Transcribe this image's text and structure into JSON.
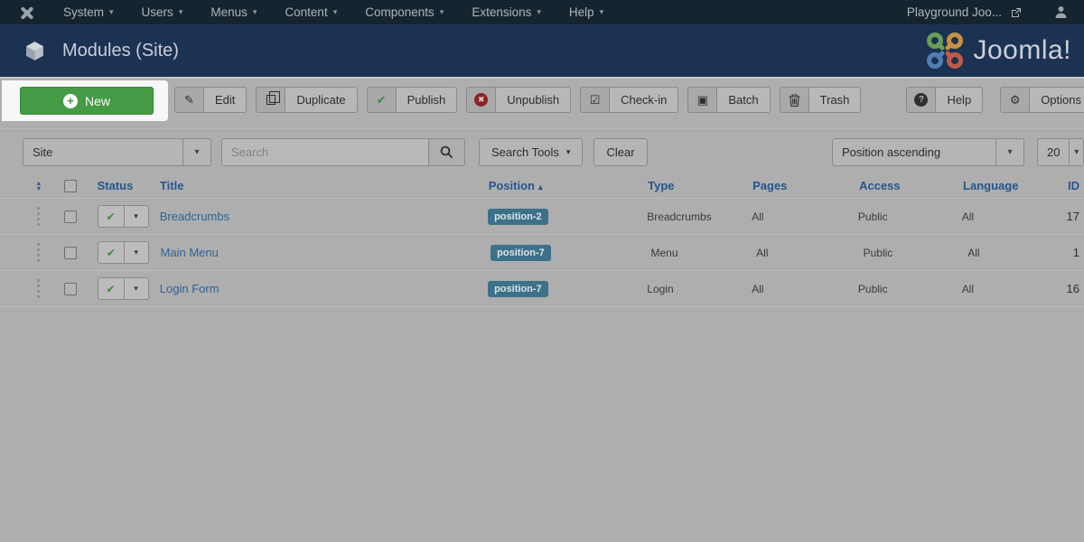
{
  "menubar": {
    "items": [
      {
        "label": "System"
      },
      {
        "label": "Users"
      },
      {
        "label": "Menus"
      },
      {
        "label": "Content"
      },
      {
        "label": "Components"
      },
      {
        "label": "Extensions"
      },
      {
        "label": "Help"
      }
    ],
    "site_name": "Playground Joo..."
  },
  "titlebar": {
    "title": "Modules (Site)",
    "logo_text": "Joomla!"
  },
  "toolbar": {
    "new_label": "New",
    "edit_label": "Edit",
    "duplicate_label": "Duplicate",
    "publish_label": "Publish",
    "unpublish_label": "Unpublish",
    "checkin_label": "Check-in",
    "batch_label": "Batch",
    "trash_label": "Trash",
    "help_label": "Help",
    "options_label": "Options"
  },
  "filters": {
    "client_selected": "Site",
    "search_placeholder": "Search",
    "search_tools_label": "Search Tools",
    "clear_label": "Clear",
    "ordering_selected": "Position ascending",
    "limit_selected": "20"
  },
  "table": {
    "headers": {
      "status": "Status",
      "title": "Title",
      "position": "Position",
      "type": "Type",
      "pages": "Pages",
      "access": "Access",
      "language": "Language",
      "id": "ID"
    },
    "rows": [
      {
        "title": "Breadcrumbs",
        "position": "position-2",
        "type": "Breadcrumbs",
        "pages": "All",
        "access": "Public",
        "language": "All",
        "id": "17"
      },
      {
        "title": "Main Menu",
        "position": "position-7",
        "type": "Menu",
        "pages": "All",
        "access": "Public",
        "language": "All",
        "id": "1"
      },
      {
        "title": "Login Form",
        "position": "position-7",
        "type": "Login",
        "pages": "All",
        "access": "Public",
        "language": "All",
        "id": "16"
      }
    ]
  },
  "icons": {
    "caret_down": "▾",
    "sort_up": "▴",
    "sort_down": "▾",
    "asc_arrow": "▴",
    "check": "✔",
    "x_mark": "✖",
    "checkin": "☑",
    "batch": "▣",
    "pencil": "✎",
    "gear": "⚙",
    "question": "?",
    "plus": "+"
  },
  "colors": {
    "accent_green": "#459a45",
    "badge_blue": "#3d7189",
    "navy": "#1c3253",
    "header_blue": "#24568e"
  }
}
